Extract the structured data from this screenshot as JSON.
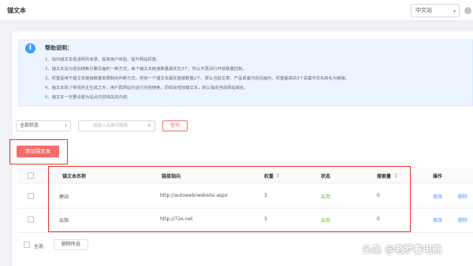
{
  "header": {
    "title": "锚文本",
    "site_select": "中文站"
  },
  "notice": {
    "title": "帮助说明：",
    "lines": [
      "1、站内锚文本促进网页收录、提高用户体验、提升网站权重。",
      "2、锚文本是为增加搜索引擎页面的一种方式，每个锚文本链接数量最优在3个，所以不再另行开放数量控制。",
      "3、权重是用于锚文本链接数量有限制的判断方式，例如一个锚文本最优链接数量2个，那么当前文章、产品或者内容页面内，权重最高的3个关键字优先转化为链接。",
      "4、锚文本除了常规自主生成之外，用户再网站内进行内容搜索，同样会增加锚文本，默认指向当前网站域名。",
      "5、锚文本一定要设置为站点内容相关的内容。"
    ]
  },
  "filters": {
    "status_select": "全部状态",
    "search_placeholder": "请输入关键词搜索",
    "query_label": "查询"
  },
  "toolbar": {
    "add_label": "添加锚文本"
  },
  "table": {
    "columns": {
      "name": "锚文本名称",
      "link": "链接指向",
      "weight": "权重",
      "status": "状态",
      "search_count": "搜索量",
      "actions": "操作"
    },
    "rows": [
      {
        "name": "建站",
        "link": "http://autoweb/website.aspx",
        "weight": "3",
        "status": "启用",
        "search_count": "0",
        "edit": "修改",
        "delete": "删除"
      },
      {
        "name": "云指",
        "link": "http://72e.net",
        "weight": "3",
        "status": "启用",
        "search_count": "0",
        "edit": "修改",
        "delete": "删除"
      }
    ]
  },
  "footer": {
    "select_all_label": "全选",
    "batch_delete_label": "删除所选"
  },
  "watermark": {
    "text": "头条 @老罗看电商"
  },
  "colors": {
    "primary": "#409eff",
    "danger": "#f56c6c",
    "success": "#67c23a",
    "highlight_frame": "#e5362a"
  }
}
